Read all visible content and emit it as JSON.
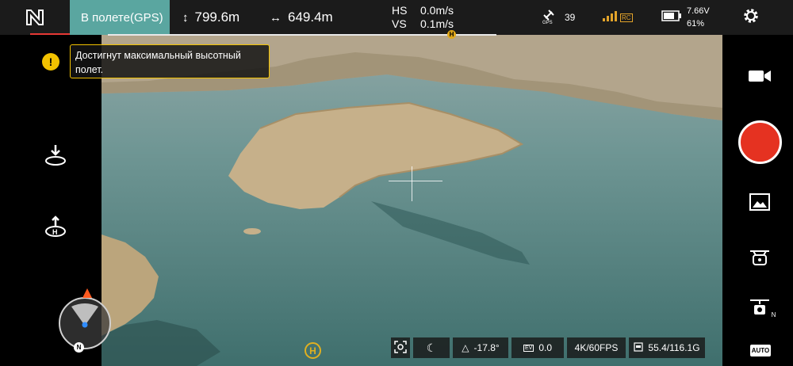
{
  "status": {
    "flight_mode": "В полете(GPS)",
    "altitude": "799.6m",
    "distance": "649.4m",
    "hs_label": "HS",
    "hs_value": "0.0m/s",
    "vs_label": "VS",
    "vs_value": "0.1m/s",
    "gps_count": "39",
    "rc_label": "RC",
    "battery_voltage": "7.66V",
    "battery_percent": "61%",
    "gps_label": "GPS"
  },
  "warning": {
    "text": "Достигнут максимальный высотный полет."
  },
  "home_marker": "H",
  "compass_north": "N",
  "camera_bar": {
    "exposure_angle": "-17.8°",
    "ev_label": "EV",
    "ev_value": "0.0",
    "resolution": "4K/60FPS",
    "storage": "55.4/116.1G"
  },
  "right_panel": {
    "auto_label": "AUTO",
    "follow_label": "N"
  },
  "colors": {
    "status_accent": "#5aa6a0",
    "record": "#e53221",
    "warning": "#f2c200",
    "home": "#e0a81a"
  },
  "icons": [
    "logo-icon",
    "altitude-icon",
    "distance-icon",
    "satellite-icon",
    "signal-icon",
    "battery-icon",
    "settings-icon",
    "warning-icon",
    "takeoff-icon",
    "return-home-icon",
    "video-mode-icon",
    "gallery-icon",
    "drone-icon",
    "follow-icon",
    "auto-icon",
    "face-detect-icon",
    "night-icon",
    "exposure-icon",
    "sd-card-icon"
  ]
}
